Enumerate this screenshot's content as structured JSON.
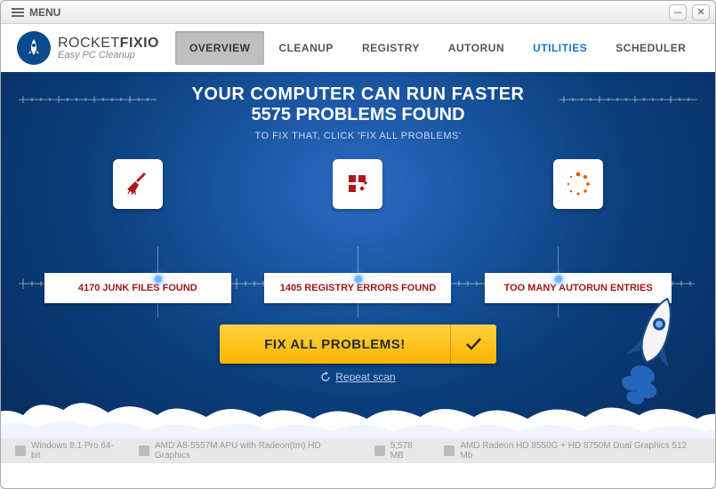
{
  "titlebar": {
    "menu_label": "MENU"
  },
  "brand": {
    "name_part1": "ROCKET",
    "name_part2": "FIXIO",
    "tagline": "Easy PC Cleanup"
  },
  "tabs": {
    "overview": "OVERVIEW",
    "cleanup": "CLEANUP",
    "registry": "REGISTRY",
    "autorun": "AUTORUN",
    "utilities": "UTILITIES",
    "scheduler": "SCHEDULER"
  },
  "headline": {
    "line1": "YOUR COMPUTER CAN RUN FASTER",
    "line2": "5575 PROBLEMS FOUND",
    "line3": "TO FIX THAT, CLICK 'FIX ALL PROBLEMS'"
  },
  "results": {
    "junk": "4170 JUNK FILES FOUND",
    "registry": "1405 REGISTRY ERRORS FOUND",
    "autorun": "TOO MANY AUTORUN ENTRIES"
  },
  "actions": {
    "fix_label": "FIX ALL PROBLEMS!",
    "repeat_label": "Repeat scan"
  },
  "footer": {
    "os": "Windows 8.1 Pro 64-bit",
    "cpu": "AMD A8-5557M APU with Radeon(tm) HD Graphics",
    "ram": "5,578 MB",
    "gpu": "AMD Radeon HD 8550G + HD 8750M Dual Graphics 512 Mb"
  },
  "colors": {
    "accent_yellow": "#f7b500",
    "danger_red": "#a01818",
    "link_blue": "#1976d2",
    "bg_blue_center": "#2a6bc4",
    "bg_blue_edge": "#072b5a"
  }
}
